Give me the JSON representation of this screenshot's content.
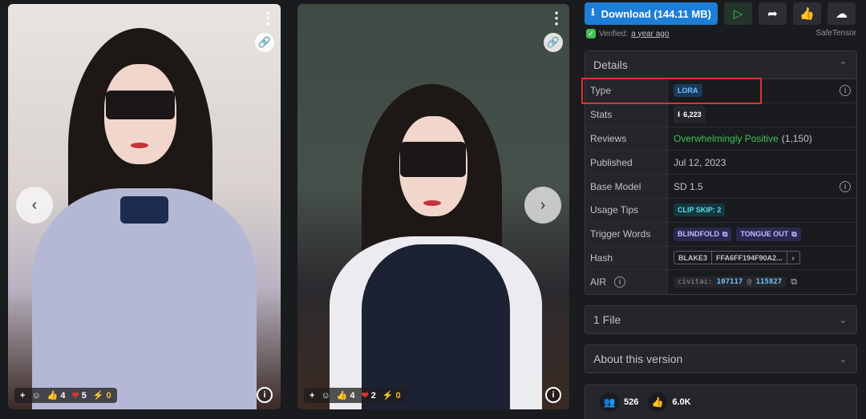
{
  "gallery": {
    "cards": [
      {
        "reactions": {
          "add": "+",
          "smile": "☺",
          "like_icon": "👍",
          "likes": "4",
          "heart_icon": "❤",
          "hearts": "5",
          "bolt_icon": "⚡",
          "bolts": "0"
        },
        "info": "i"
      },
      {
        "reactions": {
          "add": "+",
          "smile": "☺",
          "like_icon": "👍",
          "likes": "4",
          "heart_icon": "❤",
          "hearts": "2",
          "bolt_icon": "⚡",
          "bolts": "0"
        },
        "info": "i"
      }
    ],
    "prev_icon": "‹",
    "next_icon": "›",
    "menu_icon": "⋮",
    "link_icon": "🔗"
  },
  "toolbar": {
    "download_icon": "⭳",
    "download_label": "Download (144.11 MB)",
    "play_icon": "▷",
    "share_icon": "➦",
    "like_icon": "👍",
    "cloud_icon": "☁"
  },
  "verified": {
    "shield": "✓",
    "label": "Verified:",
    "when": "a year ago",
    "format": "SafeTensor"
  },
  "details": {
    "title": "Details",
    "collapse_icon": "⌃",
    "rows": {
      "type": {
        "label": "Type",
        "value": "LORA"
      },
      "stats": {
        "label": "Stats",
        "download_icon": "⭳",
        "downloads": "6,223"
      },
      "reviews": {
        "label": "Reviews",
        "sentiment": "Overwhelmingly Positive",
        "count": "(1,150)"
      },
      "published": {
        "label": "Published",
        "value": "Jul 12, 2023"
      },
      "base_model": {
        "label": "Base Model",
        "value": "SD 1.5"
      },
      "usage_tips": {
        "label": "Usage Tips",
        "value": "CLIP SKIP: 2"
      },
      "trigger_words": {
        "label": "Trigger Words",
        "words": [
          "BLINDFOLD",
          "TONGUE OUT"
        ]
      },
      "hash": {
        "label": "Hash",
        "algo": "BLAKE3",
        "value": "FFA6FF194F90A2...",
        "go": "›"
      },
      "air": {
        "label": "AIR",
        "prefix": "civitai:",
        "model_id": "107117",
        "at": "@",
        "version_id": "115827"
      }
    },
    "info_icon": "i",
    "copy_icon": "⧉"
  },
  "accordions": {
    "files": {
      "label": "1 File",
      "chevron": "⌄"
    },
    "about": {
      "label": "About this version",
      "chevron": "⌄"
    }
  },
  "footer": {
    "users_icon": "👥",
    "users": "526",
    "like_icon": "👍",
    "likes": "6.0K"
  },
  "colors": {
    "accent": "#1c7ed6",
    "positive": "#40c057",
    "highlight": "#e03131"
  }
}
